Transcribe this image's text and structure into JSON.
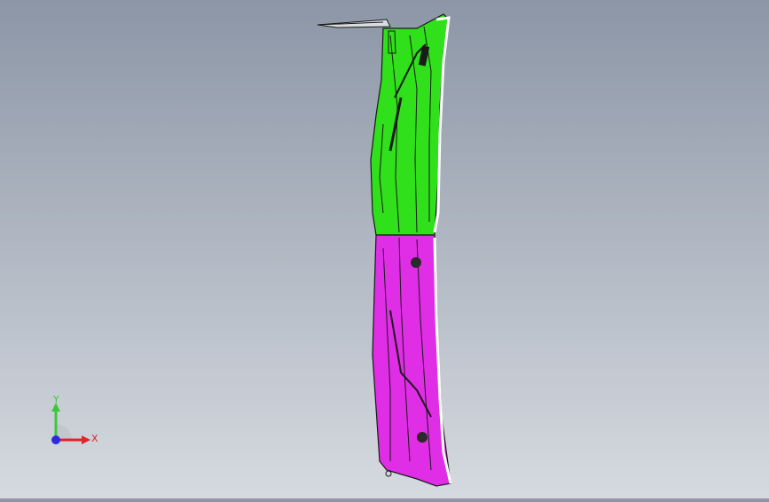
{
  "viewport": {
    "background_top": "#8c96a6",
    "background_bottom": "#d6dae0"
  },
  "part": {
    "upper_color": "#2fe01a",
    "lower_color": "#e02de6",
    "edge_color": "#1a1a1a"
  },
  "triad": {
    "x_label": "X",
    "y_label": "Y",
    "x_color": "#e0242a",
    "y_color": "#3cc83c",
    "z_color": "#2a2ae0",
    "icon": "coordinate-triad-icon"
  }
}
